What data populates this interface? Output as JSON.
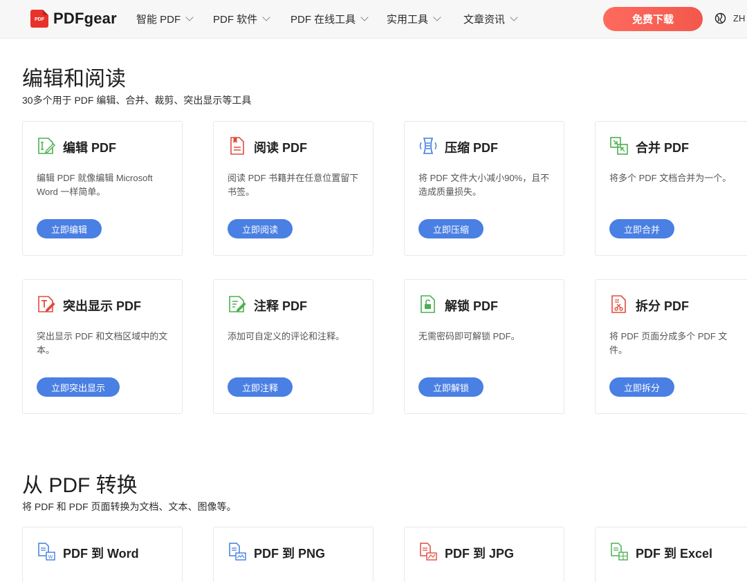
{
  "header": {
    "logo_text": "PDFgear",
    "logo_badge": "PDF",
    "nav": [
      "智能 PDF",
      "PDF 软件",
      "PDF 在线工具",
      "实用工具",
      "文章资讯"
    ],
    "download_label": "免费下载",
    "lang_label": "ZH"
  },
  "edit_section": {
    "title": "编辑和阅读",
    "subtitle": "30多个用于 PDF 编辑、合并、裁剪、突出显示等工具",
    "cards": [
      {
        "title": "编辑 PDF",
        "desc": "编辑 PDF 就像编辑 Microsoft Word 一样简单。",
        "button": "立即编辑",
        "icon": "edit-pdf-icon"
      },
      {
        "title": "阅读 PDF",
        "desc": "阅读 PDF 书籍并在任意位置留下书签。",
        "button": "立即阅读",
        "icon": "read-pdf-icon"
      },
      {
        "title": "压缩 PDF",
        "desc": "将 PDF 文件大小减小90%，且不造成质量损失。",
        "button": "立即压缩",
        "icon": "compress-pdf-icon"
      },
      {
        "title": "合并 PDF",
        "desc": "将多个 PDF 文档合并为一个。",
        "button": "立即合并",
        "icon": "merge-pdf-icon"
      },
      {
        "title": "突出显示 PDF",
        "desc": "突出显示 PDF 和文档区域中的文本。",
        "button": "立即突出显示",
        "icon": "highlight-pdf-icon"
      },
      {
        "title": "注释 PDF",
        "desc": "添加可自定义的评论和注释。",
        "button": "立即注释",
        "icon": "annotate-pdf-icon"
      },
      {
        "title": "解锁 PDF",
        "desc": "无需密码即可解锁 PDF。",
        "button": "立即解锁",
        "icon": "unlock-pdf-icon"
      },
      {
        "title": "拆分 PDF",
        "desc": "将 PDF 页面分成多个 PDF 文件。",
        "button": "立即拆分",
        "icon": "split-pdf-icon"
      }
    ]
  },
  "convert_section": {
    "title": "从 PDF 转换",
    "subtitle": "将 PDF 和 PDF 页面转换为文档、文本、图像等。",
    "cards": [
      {
        "title": "PDF 到 Word",
        "icon": "pdf-to-word-icon"
      },
      {
        "title": "PDF 到 PNG",
        "icon": "pdf-to-png-icon"
      },
      {
        "title": "PDF 到 JPG",
        "icon": "pdf-to-jpg-icon"
      },
      {
        "title": "PDF 到 Excel",
        "icon": "pdf-to-excel-icon"
      }
    ]
  },
  "colors": {
    "accent": "#4a7fe3",
    "download_gradient_start": "#ff6a5e",
    "download_gradient_end": "#f2584b",
    "brand_red": "#e8332b",
    "icon_green": "#4caf50",
    "icon_red": "#e04b3c",
    "icon_blue": "#3f7de0"
  }
}
